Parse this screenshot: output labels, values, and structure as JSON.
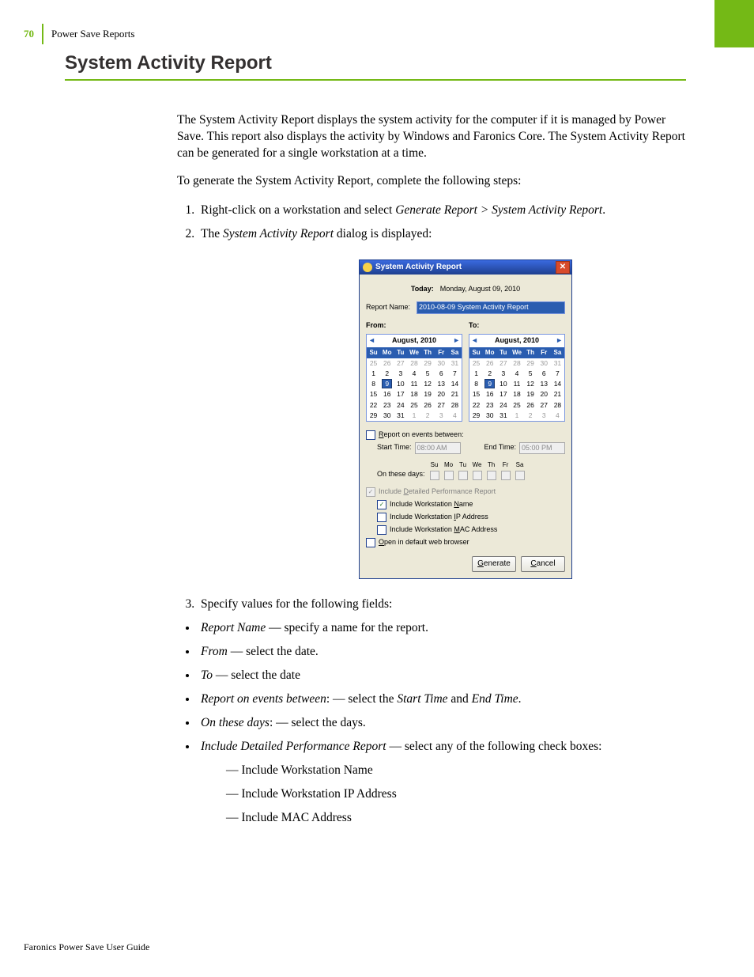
{
  "page": {
    "number": "70",
    "header_section": "Power Save Reports",
    "heading": "System Activity Report",
    "para1": "The System Activity Report displays the system activity for the computer if it is managed by Power Save. This report also displays the activity by Windows and Faronics Core. The System Activity Report can be generated for a single workstation at a time.",
    "para2": "To generate the System Activity Report, complete the following steps:",
    "steps": {
      "s1_a": "Right-click on a workstation and select ",
      "s1_em": "Generate Report > System Activity Report",
      "s1_b": ".",
      "s2_a": "The ",
      "s2_em": "System Activity Report",
      "s2_b": " dialog is displayed:",
      "s3": "Specify values for the following fields:"
    },
    "bullets": {
      "b1_em": "Report Name",
      "b1_t": " — specify a name for the report.",
      "b2_em": "From",
      "b2_t": " — select the date.",
      "b3_em": "To",
      "b3_t": " — select the date",
      "b4_em": "Report on events between",
      "b4_t": ": — select the ",
      "b4_em2": "Start Time",
      "b4_mid": " and ",
      "b4_em3": "End Time",
      "b4_end": ".",
      "b5_em": "On these days",
      "b5_t": ": — select the days.",
      "b6_em": "Include Detailed Performance Report",
      "b6_t": " — select any of the following check boxes:",
      "sub1": "Include Workstation Name",
      "sub2": "Include Workstation IP Address",
      "sub3": "Include MAC Address"
    },
    "footer": "Faronics Power Save User Guide"
  },
  "dialog": {
    "title": "System Activity Report",
    "today_label": "Today:",
    "today_value": "Monday, August 09, 2010",
    "report_name_label": "Report Name:",
    "report_name_value": "2010-08-09  System Activity Report",
    "from_label": "From:",
    "to_label": "To:",
    "month": "August, 2010",
    "dayhdr": [
      "Su",
      "Mo",
      "Tu",
      "We",
      "Th",
      "Fr",
      "Sa"
    ],
    "weeks": [
      [
        {
          "d": "25",
          "dim": true
        },
        {
          "d": "26",
          "dim": true
        },
        {
          "d": "27",
          "dim": true
        },
        {
          "d": "28",
          "dim": true
        },
        {
          "d": "29",
          "dim": true
        },
        {
          "d": "30",
          "dim": true
        },
        {
          "d": "31",
          "dim": true
        }
      ],
      [
        {
          "d": "1"
        },
        {
          "d": "2"
        },
        {
          "d": "3"
        },
        {
          "d": "4"
        },
        {
          "d": "5"
        },
        {
          "d": "6"
        },
        {
          "d": "7"
        }
      ],
      [
        {
          "d": "8"
        },
        {
          "d": "9",
          "sel": true
        },
        {
          "d": "10"
        },
        {
          "d": "11"
        },
        {
          "d": "12"
        },
        {
          "d": "13"
        },
        {
          "d": "14"
        }
      ],
      [
        {
          "d": "15"
        },
        {
          "d": "16"
        },
        {
          "d": "17"
        },
        {
          "d": "18"
        },
        {
          "d": "19"
        },
        {
          "d": "20"
        },
        {
          "d": "21"
        }
      ],
      [
        {
          "d": "22"
        },
        {
          "d": "23"
        },
        {
          "d": "24"
        },
        {
          "d": "25"
        },
        {
          "d": "26"
        },
        {
          "d": "27"
        },
        {
          "d": "28"
        }
      ],
      [
        {
          "d": "29"
        },
        {
          "d": "30"
        },
        {
          "d": "31"
        },
        {
          "d": "1",
          "dim": true
        },
        {
          "d": "2",
          "dim": true
        },
        {
          "d": "3",
          "dim": true
        },
        {
          "d": "4",
          "dim": true
        }
      ]
    ],
    "report_between_label": "Report on events between:",
    "start_time_label": "Start Time:",
    "start_time_value": "08:00 AM",
    "end_time_label": "End Time:",
    "end_time_value": "05:00 PM",
    "on_these_days_label": "On these days:",
    "days_short": [
      "Su",
      "Mo",
      "Tu",
      "We",
      "Th",
      "Fr",
      "Sa"
    ],
    "detailed_label": "Include Detailed Performance Report",
    "inc_ws_name": "Include Workstation Name",
    "inc_ws_ip": "Include Workstation IP Address",
    "inc_ws_mac": "Include Workstation MAC Address",
    "open_browser": "Open in default web browser",
    "btn_generate": "Generate",
    "btn_cancel": "Cancel"
  }
}
